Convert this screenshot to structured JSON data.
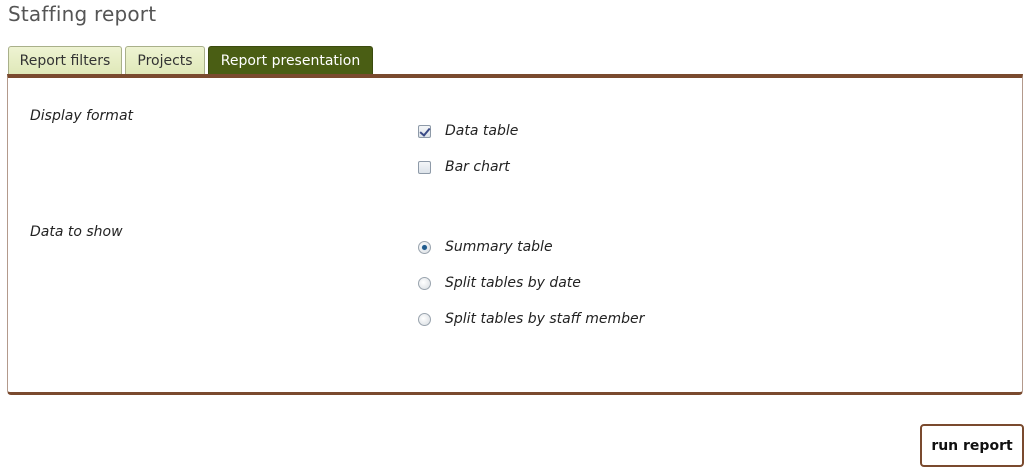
{
  "page": {
    "title": "Staffing report"
  },
  "tabs": [
    {
      "label": "Report filters",
      "active": false
    },
    {
      "label": "Projects",
      "active": false
    },
    {
      "label": "Report presentation",
      "active": true
    }
  ],
  "display_format": {
    "label": "Display format",
    "options": [
      {
        "label": "Data table",
        "checked": true
      },
      {
        "label": "Bar chart",
        "checked": false
      }
    ]
  },
  "data_to_show": {
    "label": "Data to show",
    "options": [
      {
        "label": "Summary table",
        "selected": true
      },
      {
        "label": "Split tables by date",
        "selected": false
      },
      {
        "label": "Split tables by staff member",
        "selected": false
      }
    ]
  },
  "actions": {
    "run_label": "run report"
  },
  "colors": {
    "active_tab": "#4a5e14",
    "panel_border": "#7a4a2e",
    "tab_bg": "#e6edc4"
  }
}
